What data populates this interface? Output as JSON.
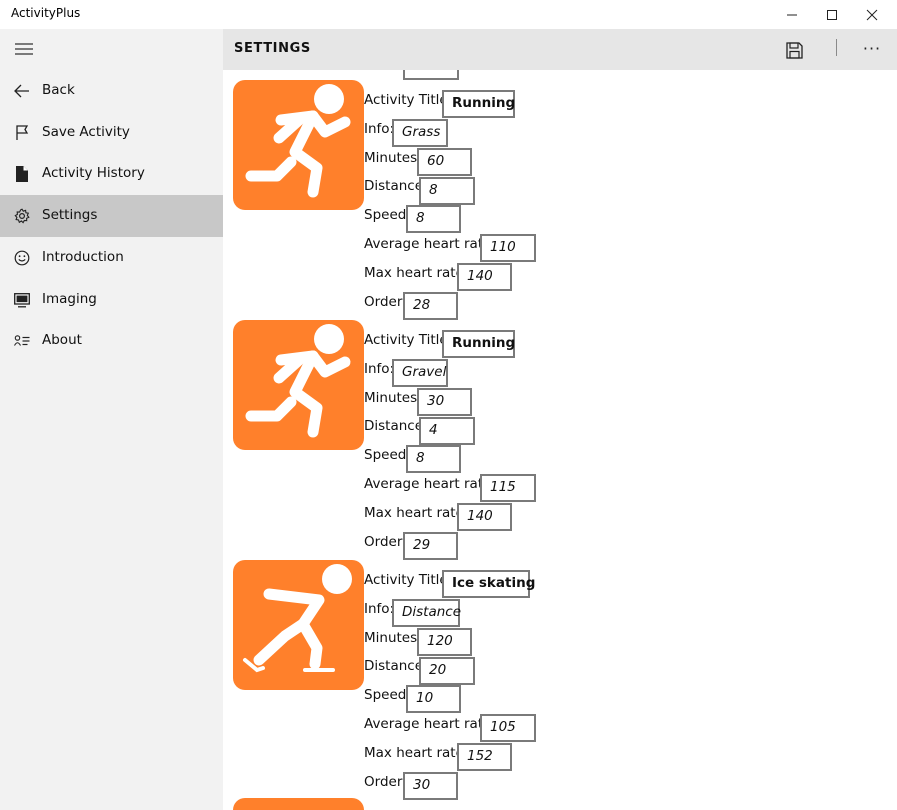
{
  "app": {
    "title": "ActivityPlus"
  },
  "window": {
    "minimize_glyph": "—",
    "maximize_glyph": "☐",
    "close_glyph": "✕"
  },
  "nav": {
    "items": [
      {
        "label": "Back",
        "icon": "back-arrow-icon"
      },
      {
        "label": "Save Activity",
        "icon": "flag-icon"
      },
      {
        "label": "Activity History",
        "icon": "document-icon"
      },
      {
        "label": "Settings",
        "icon": "gear-icon",
        "selected": true
      },
      {
        "label": "Introduction",
        "icon": "smiley-icon"
      },
      {
        "label": "Imaging",
        "icon": "monitor-icon"
      },
      {
        "label": "About",
        "icon": "contact-info-icon"
      }
    ]
  },
  "header": {
    "title": "SETTINGS",
    "more": "···"
  },
  "labels": {
    "title": "Activity Title:",
    "info": "Info:",
    "minutes": "Minutes:",
    "distance": "Distance:",
    "speed": "Speed:",
    "avg_hr": "Average heart rate:",
    "max_hr": "Max heart rate:",
    "order": "Order:"
  },
  "activities": [
    {
      "icon": "running-icon",
      "title": "Running",
      "info": "Grass",
      "minutes": "60",
      "distance": "8",
      "speed": "8",
      "avg_hr": "110",
      "max_hr": "140",
      "order": "28"
    },
    {
      "icon": "running-icon",
      "title": "Running",
      "info": "Gravel",
      "minutes": "30",
      "distance": "4",
      "speed": "8",
      "avg_hr": "115",
      "max_hr": "140",
      "order": "29"
    },
    {
      "icon": "ice-skating-icon",
      "title": "Ice skating",
      "info": "Distance",
      "minutes": "120",
      "distance": "20",
      "speed": "10",
      "avg_hr": "105",
      "max_hr": "152",
      "order": "30"
    }
  ],
  "colors": {
    "accent": "#ff802b",
    "nav_bg": "#f2f2f2",
    "nav_selected": "#c8c8c8",
    "header_bg": "#e6e6e6"
  }
}
